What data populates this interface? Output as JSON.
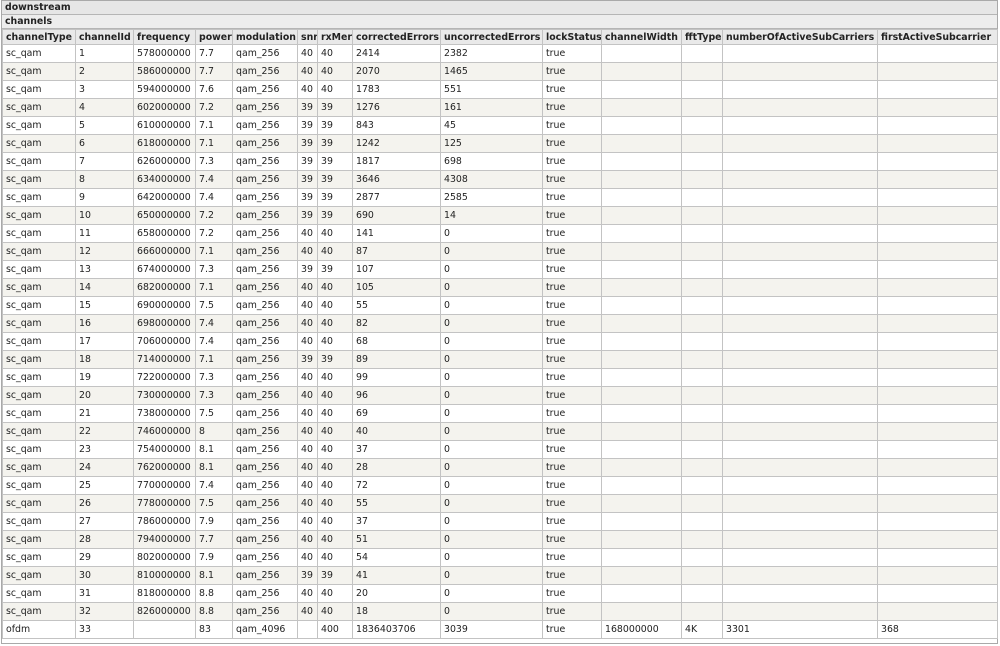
{
  "section_title": "downstream",
  "subsection_title": "channels",
  "columns": [
    "channelType",
    "channelId",
    "frequency",
    "power",
    "modulation",
    "snr",
    "rxMer",
    "correctedErrors",
    "uncorrectedErrors",
    "lockStatus",
    "channelWidth",
    "fftType",
    "numberOfActiveSubCarriers",
    "firstActiveSubcarrier"
  ],
  "rows": [
    [
      "sc_qam",
      "1",
      "578000000",
      "7.7",
      "qam_256",
      "40",
      "40",
      "2414",
      "2382",
      "true",
      "",
      "",
      "",
      ""
    ],
    [
      "sc_qam",
      "2",
      "586000000",
      "7.7",
      "qam_256",
      "40",
      "40",
      "2070",
      "1465",
      "true",
      "",
      "",
      "",
      ""
    ],
    [
      "sc_qam",
      "3",
      "594000000",
      "7.6",
      "qam_256",
      "40",
      "40",
      "1783",
      "551",
      "true",
      "",
      "",
      "",
      ""
    ],
    [
      "sc_qam",
      "4",
      "602000000",
      "7.2",
      "qam_256",
      "39",
      "39",
      "1276",
      "161",
      "true",
      "",
      "",
      "",
      ""
    ],
    [
      "sc_qam",
      "5",
      "610000000",
      "7.1",
      "qam_256",
      "39",
      "39",
      "843",
      "45",
      "true",
      "",
      "",
      "",
      ""
    ],
    [
      "sc_qam",
      "6",
      "618000000",
      "7.1",
      "qam_256",
      "39",
      "39",
      "1242",
      "125",
      "true",
      "",
      "",
      "",
      ""
    ],
    [
      "sc_qam",
      "7",
      "626000000",
      "7.3",
      "qam_256",
      "39",
      "39",
      "1817",
      "698",
      "true",
      "",
      "",
      "",
      ""
    ],
    [
      "sc_qam",
      "8",
      "634000000",
      "7.4",
      "qam_256",
      "39",
      "39",
      "3646",
      "4308",
      "true",
      "",
      "",
      "",
      ""
    ],
    [
      "sc_qam",
      "9",
      "642000000",
      "7.4",
      "qam_256",
      "39",
      "39",
      "2877",
      "2585",
      "true",
      "",
      "",
      "",
      ""
    ],
    [
      "sc_qam",
      "10",
      "650000000",
      "7.2",
      "qam_256",
      "39",
      "39",
      "690",
      "14",
      "true",
      "",
      "",
      "",
      ""
    ],
    [
      "sc_qam",
      "11",
      "658000000",
      "7.2",
      "qam_256",
      "40",
      "40",
      "141",
      "0",
      "true",
      "",
      "",
      "",
      ""
    ],
    [
      "sc_qam",
      "12",
      "666000000",
      "7.1",
      "qam_256",
      "40",
      "40",
      "87",
      "0",
      "true",
      "",
      "",
      "",
      ""
    ],
    [
      "sc_qam",
      "13",
      "674000000",
      "7.3",
      "qam_256",
      "39",
      "39",
      "107",
      "0",
      "true",
      "",
      "",
      "",
      ""
    ],
    [
      "sc_qam",
      "14",
      "682000000",
      "7.1",
      "qam_256",
      "40",
      "40",
      "105",
      "0",
      "true",
      "",
      "",
      "",
      ""
    ],
    [
      "sc_qam",
      "15",
      "690000000",
      "7.5",
      "qam_256",
      "40",
      "40",
      "55",
      "0",
      "true",
      "",
      "",
      "",
      ""
    ],
    [
      "sc_qam",
      "16",
      "698000000",
      "7.4",
      "qam_256",
      "40",
      "40",
      "82",
      "0",
      "true",
      "",
      "",
      "",
      ""
    ],
    [
      "sc_qam",
      "17",
      "706000000",
      "7.4",
      "qam_256",
      "40",
      "40",
      "68",
      "0",
      "true",
      "",
      "",
      "",
      ""
    ],
    [
      "sc_qam",
      "18",
      "714000000",
      "7.1",
      "qam_256",
      "39",
      "39",
      "89",
      "0",
      "true",
      "",
      "",
      "",
      ""
    ],
    [
      "sc_qam",
      "19",
      "722000000",
      "7.3",
      "qam_256",
      "40",
      "40",
      "99",
      "0",
      "true",
      "",
      "",
      "",
      ""
    ],
    [
      "sc_qam",
      "20",
      "730000000",
      "7.3",
      "qam_256",
      "40",
      "40",
      "96",
      "0",
      "true",
      "",
      "",
      "",
      ""
    ],
    [
      "sc_qam",
      "21",
      "738000000",
      "7.5",
      "qam_256",
      "40",
      "40",
      "69",
      "0",
      "true",
      "",
      "",
      "",
      ""
    ],
    [
      "sc_qam",
      "22",
      "746000000",
      "8",
      "qam_256",
      "40",
      "40",
      "40",
      "0",
      "true",
      "",
      "",
      "",
      ""
    ],
    [
      "sc_qam",
      "23",
      "754000000",
      "8.1",
      "qam_256",
      "40",
      "40",
      "37",
      "0",
      "true",
      "",
      "",
      "",
      ""
    ],
    [
      "sc_qam",
      "24",
      "762000000",
      "8.1",
      "qam_256",
      "40",
      "40",
      "28",
      "0",
      "true",
      "",
      "",
      "",
      ""
    ],
    [
      "sc_qam",
      "25",
      "770000000",
      "7.4",
      "qam_256",
      "40",
      "40",
      "72",
      "0",
      "true",
      "",
      "",
      "",
      ""
    ],
    [
      "sc_qam",
      "26",
      "778000000",
      "7.5",
      "qam_256",
      "40",
      "40",
      "55",
      "0",
      "true",
      "",
      "",
      "",
      ""
    ],
    [
      "sc_qam",
      "27",
      "786000000",
      "7.9",
      "qam_256",
      "40",
      "40",
      "37",
      "0",
      "true",
      "",
      "",
      "",
      ""
    ],
    [
      "sc_qam",
      "28",
      "794000000",
      "7.7",
      "qam_256",
      "40",
      "40",
      "51",
      "0",
      "true",
      "",
      "",
      "",
      ""
    ],
    [
      "sc_qam",
      "29",
      "802000000",
      "7.9",
      "qam_256",
      "40",
      "40",
      "54",
      "0",
      "true",
      "",
      "",
      "",
      ""
    ],
    [
      "sc_qam",
      "30",
      "810000000",
      "8.1",
      "qam_256",
      "39",
      "39",
      "41",
      "0",
      "true",
      "",
      "",
      "",
      ""
    ],
    [
      "sc_qam",
      "31",
      "818000000",
      "8.8",
      "qam_256",
      "40",
      "40",
      "20",
      "0",
      "true",
      "",
      "",
      "",
      ""
    ],
    [
      "sc_qam",
      "32",
      "826000000",
      "8.8",
      "qam_256",
      "40",
      "40",
      "18",
      "0",
      "true",
      "",
      "",
      "",
      ""
    ],
    [
      "ofdm",
      "33",
      "",
      "83",
      "qam_4096",
      "",
      "400",
      "1836403706",
      "3039",
      "true",
      "168000000",
      "4K",
      "3301",
      "368"
    ]
  ]
}
